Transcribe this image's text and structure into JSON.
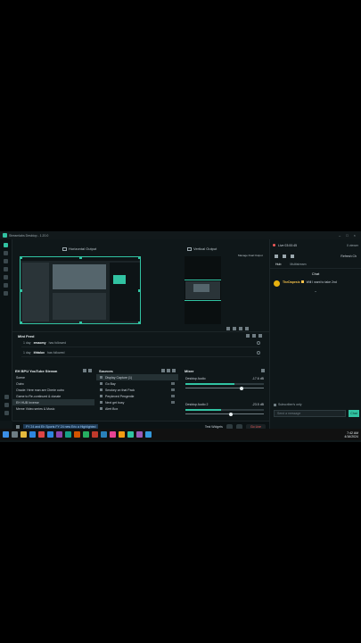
{
  "window": {
    "title": "Streamlabs Desktop - 1.20.0"
  },
  "editor": {
    "horizontal_label": "Horizontal Output",
    "vertical_label": "Vertical Output",
    "dual_output_toggle_label": "Manage Dual Output"
  },
  "mini_feed": {
    "title": "Mini Feed",
    "items": [
      {
        "time": "1 day",
        "user": "emacmy",
        "action": "has followed"
      },
      {
        "time": "1 day",
        "user": "ithtalux",
        "action": "has followed"
      }
    ]
  },
  "scenes": {
    "title": "EH BPU YouTube Stream",
    "items": [
      {
        "label": "Scene",
        "selected": false
      },
      {
        "label": "Outro",
        "selected": false
      },
      {
        "label": "Oracle: Here man are Cherie outro",
        "selected": false
      },
      {
        "label": "Game to Re-continued & donate",
        "selected": false
      },
      {
        "label": "EH HUB Inverse",
        "selected": true
      },
      {
        "label": "Meme Video series & Music",
        "selected": false
      }
    ]
  },
  "sources": {
    "title": "Sources",
    "items": [
      {
        "label": "Display Capture (1)",
        "selected": true
      },
      {
        "label": "Go Bay",
        "selected": false
      },
      {
        "label": "Smokey on that Pack",
        "selected": false
      },
      {
        "label": "Perplexed Pengentle",
        "selected": false
      },
      {
        "label": "Next get busy",
        "selected": false
      },
      {
        "label": "Alert Box",
        "selected": false
      }
    ]
  },
  "mixer": {
    "title": "Mixer",
    "channels": [
      {
        "name": "Desktop Audio",
        "db": "-17.6 dB",
        "level": 0.62,
        "volume": 0.72
      },
      {
        "name": "Desktop Audio 2",
        "db": "-23.5 dB",
        "level": 0.45,
        "volume": 0.58
      }
    ]
  },
  "statusbar": {
    "ticker": "FY 24 and Eh Sports FY 24 new Eric a Highlighted",
    "test_widgets": "Test Widgets",
    "go_live": "Go Live"
  },
  "chat": {
    "live_label": "Live 03:00:45",
    "viewers": "0 viewer",
    "refresh_label": "Refresh Ch",
    "tabs": [
      "Hub",
      "Multistream"
    ],
    "title": "Chat",
    "message_author": "TheDapesic",
    "message_text": "Will I want to take 2nd",
    "subscribers_note": "Subscriber's only",
    "input_placeholder": "Send a message",
    "send_label": "Chat"
  },
  "taskbar": {
    "time": "7:42 AM",
    "date": "4/16/2024"
  },
  "colors": {
    "accent": "#31c3a2",
    "live": "#f15a5a",
    "background": "#0f1719"
  }
}
